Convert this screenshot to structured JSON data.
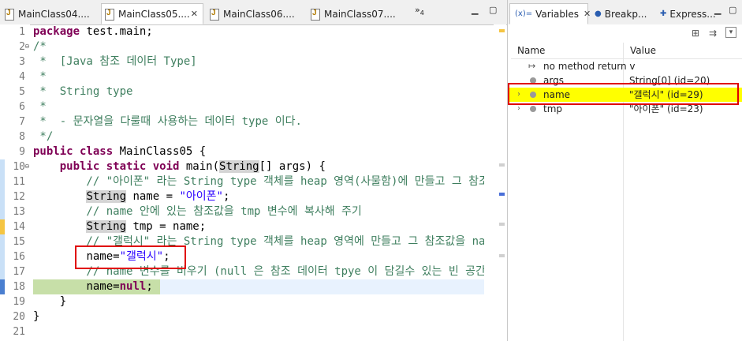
{
  "editor": {
    "tabs": [
      {
        "label": "MainClass04....",
        "active": false
      },
      {
        "label": "MainClass05....",
        "active": true
      },
      {
        "label": "MainClass06....",
        "active": false
      },
      {
        "label": "MainClass07....",
        "active": false
      }
    ],
    "overflow_count": "4",
    "line_numbers": [
      "1",
      "2",
      "3",
      "4",
      "5",
      "6",
      "7",
      "8",
      "9",
      "10",
      "11",
      "12",
      "13",
      "14",
      "15",
      "16",
      "17",
      "18",
      "19",
      "20",
      "21"
    ],
    "code": {
      "l1_kw": "package",
      "l1_rest": " test.main;",
      "l2": "/*",
      "l3": " *  [Java 참조 데이터 Type]",
      "l4": " *",
      "l5": " *  String type",
      "l6": " *",
      "l7": " *  - 문자열을 다룰때 사용하는 데이터 type 이다.",
      "l8": " */",
      "l9_kw": "public class",
      "l9_rest": " MainClass05 {",
      "l10_indent": "    ",
      "l10_kw": "public static void",
      "l10_a": " main(",
      "l10_type": "String",
      "l10_b": "[] args) {",
      "l11": "        // \"아이폰\" 라는 String type 객체를 heap 영역(사물함)에 만들고 그 참조",
      "l12_indent": "        ",
      "l12_type": "String",
      "l12_a": " name = ",
      "l12_str": "\"아이폰\"",
      "l12_b": ";",
      "l13": "        // name 안에 있는 참조값을 tmp 변수에 복사해 주기",
      "l14_indent": "        ",
      "l14_type": "String",
      "l14_a": " tmp = name;",
      "l15": "        // \"갤럭시\" 라는 String type 객체를 heap 영역에 만들고 그 참조값을 na",
      "l16_indent": "        ",
      "l16_a": "name=",
      "l16_str": "\"갤럭시\"",
      "l16_b": ";",
      "l17": "        // name 변수를 비우기 (null 은 참조 데이터 tpye 이 담길수 있는 빈 공간",
      "l18_indent": "        ",
      "l18_a": "name=",
      "l18_kw": "null",
      "l18_b": ";",
      "l19": "    }",
      "l20": "}",
      "l21": ""
    }
  },
  "variables": {
    "tabs": [
      {
        "icon": "(x)=",
        "label": "Variables"
      },
      {
        "label": "Breakp..."
      },
      {
        "label": "Express..."
      }
    ],
    "columns": {
      "name": "Name",
      "value": "Value"
    },
    "rows": [
      {
        "name": "no method return v",
        "value": ""
      },
      {
        "name": "args",
        "value": "String[0]  (id=20)"
      },
      {
        "name": "name",
        "value": "\"갤럭시\" (id=29)"
      },
      {
        "name": "tmp",
        "value": "\"아이폰\" (id=23)"
      }
    ]
  },
  "colors": {
    "keyword": "#7f0055",
    "comment": "#3f7f5f",
    "string": "#2a00ff",
    "selection_highlight": "#ffff00",
    "annotation_box": "#e00000"
  }
}
